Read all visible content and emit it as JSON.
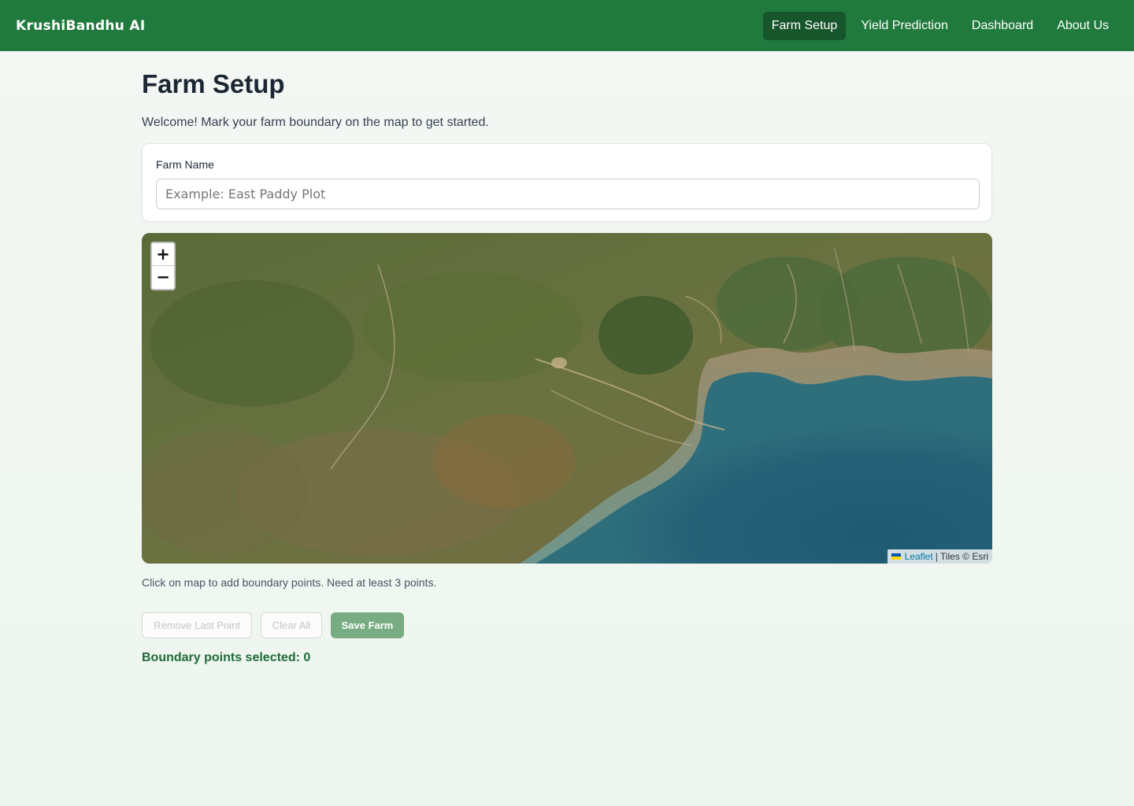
{
  "nav": {
    "brand": "KrushiBandhu AI",
    "links": [
      {
        "label": "Farm Setup",
        "active": true
      },
      {
        "label": "Yield Prediction",
        "active": false
      },
      {
        "label": "Dashboard",
        "active": false
      },
      {
        "label": "About Us",
        "active": false
      }
    ]
  },
  "page": {
    "title": "Farm Setup",
    "welcome": "Welcome! Mark your farm boundary on the map to get started."
  },
  "form": {
    "farm_name_label": "Farm Name",
    "farm_name_value": "",
    "farm_name_placeholder": "Example: East Paddy Plot"
  },
  "map": {
    "zoom_in": "+",
    "zoom_out": "−",
    "attribution_link": "Leaflet",
    "attribution_text": "| Tiles © Esri",
    "icons": [
      "ukraine-flag-icon"
    ]
  },
  "hint": "Click on map to add boundary points. Need at least 3 points.",
  "buttons": {
    "remove_last": "Remove Last Point",
    "clear_all": "Clear All",
    "save": "Save Farm"
  },
  "status": {
    "points_label": "Boundary points selected: 0"
  },
  "colors": {
    "navbar": "#217a3d",
    "nav_active": "#17552b",
    "save_button": "#78ad83",
    "points_text": "#1f6b3a",
    "attribution_link": "#0078a8"
  }
}
